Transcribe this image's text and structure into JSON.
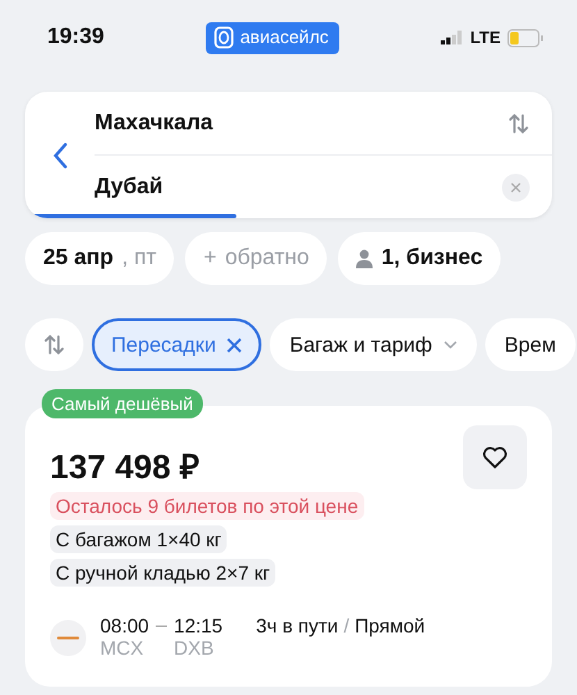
{
  "status_bar": {
    "time": "19:39",
    "app_badge": "авиасейлс",
    "network": "LTE"
  },
  "search": {
    "origin": "Махачкала",
    "destination": "Дубай",
    "progress": {
      "level": 0.4
    }
  },
  "chips": [
    {
      "kind": "date",
      "text": "25 апр",
      "suffix": ", пт"
    },
    {
      "kind": "add",
      "icon": "+",
      "text": "обратно"
    },
    {
      "kind": "passengers",
      "text": "1, бизнес"
    }
  ],
  "filters": [
    {
      "kind": "sort",
      "selected": false
    },
    {
      "kind": "toggle",
      "label": "Пересадки",
      "selected": true
    },
    {
      "kind": "dropdown",
      "label": "Багаж и тариф",
      "selected": false
    },
    {
      "kind": "dropdown",
      "label": "Врем",
      "selected": false
    }
  ],
  "ticket": {
    "badge": "Самый дешёвый",
    "price": "137 498 ₽",
    "favorite": false,
    "tags": [
      {
        "kind": "warning",
        "text": "Осталось 9 билетов по этой цене"
      },
      {
        "kind": "info",
        "text": "С багажом 1×40 кг"
      },
      {
        "kind": "info",
        "text": "С ручной кладью 2×7 кг"
      }
    ],
    "flight": {
      "departure": "08:00",
      "arrival": "12:15",
      "from": "MCX",
      "to": "DXB",
      "duration": "3ч в пути",
      "separator": "/",
      "stops": "Прямой"
    }
  }
}
